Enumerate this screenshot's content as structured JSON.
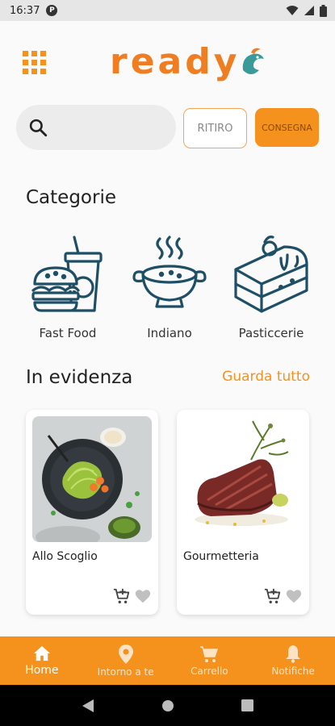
{
  "status_bar": {
    "time": "16:37",
    "badge": "P"
  },
  "header": {
    "logo_text": "ready"
  },
  "search": {
    "placeholder": ""
  },
  "modes": {
    "pickup_label": "RITIRO",
    "delivery_label": "CONSEGNA"
  },
  "categories": {
    "title": "Categorie",
    "items": [
      {
        "label": "Fast Food",
        "icon": "fast-food-icon"
      },
      {
        "label": "Indiano",
        "icon": "curry-bowl-icon"
      },
      {
        "label": "Pasticcerie",
        "icon": "cake-slice-icon"
      }
    ]
  },
  "featured": {
    "title": "In evidenza",
    "see_all_label": "Guarda tutto",
    "items": [
      {
        "name": "Allo Scoglio"
      },
      {
        "name": "Gourmetteria"
      }
    ]
  },
  "bottom_nav": {
    "items": [
      {
        "label": "Home",
        "icon": "home-icon",
        "active": true
      },
      {
        "label": "Intorno a te",
        "icon": "location-pin-icon"
      },
      {
        "label": "Carrello",
        "icon": "cart-icon"
      },
      {
        "label": "Notifiche",
        "icon": "bell-icon"
      }
    ]
  },
  "colors": {
    "accent": "#f5921e",
    "icon_teal": "#1e4f66",
    "logo_orange": "#ef7d22",
    "logo_teal": "#3a9a9a"
  }
}
